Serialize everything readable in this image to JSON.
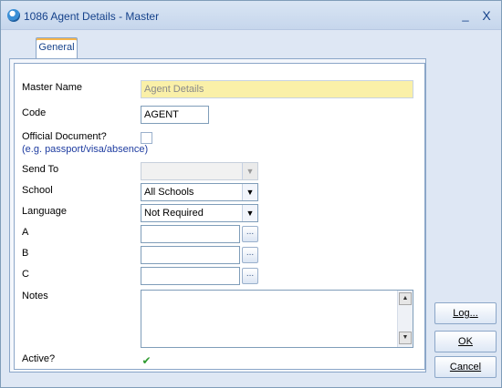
{
  "window": {
    "title": "1086 Agent Details - Master",
    "minimize_glyph": "_",
    "close_glyph": "X",
    "icon": "app-globe-icon"
  },
  "tabs": [
    {
      "label": "General",
      "selected": true
    }
  ],
  "form": {
    "master_name": {
      "label": "Master Name",
      "value": "Agent Details",
      "readonly": true
    },
    "code": {
      "label": "Code",
      "value": "AGENT"
    },
    "official_document": {
      "label": "Official Document?",
      "hint": "(e.g. passport/visa/absence)",
      "checked": false
    },
    "send_to": {
      "label": "Send To",
      "value": "",
      "disabled": true
    },
    "school": {
      "label": "School",
      "value": "All Schools"
    },
    "language": {
      "label": "Language",
      "value": "Not Required"
    },
    "a": {
      "label": "A",
      "value": ""
    },
    "b": {
      "label": "B",
      "value": ""
    },
    "c": {
      "label": "C",
      "value": ""
    },
    "ellipsis_glyph": "...",
    "notes": {
      "label": "Notes",
      "value": ""
    },
    "active": {
      "label": "Active?",
      "checked": true,
      "check_glyph": "✔"
    }
  },
  "buttons": {
    "log": "Log...",
    "ok": "OK",
    "cancel": "Cancel"
  },
  "colors": {
    "accent": "#15428b",
    "tab_highlight": "#f6b54a",
    "readonly_field": "#faf0a8",
    "check": "#2f9b2f"
  }
}
